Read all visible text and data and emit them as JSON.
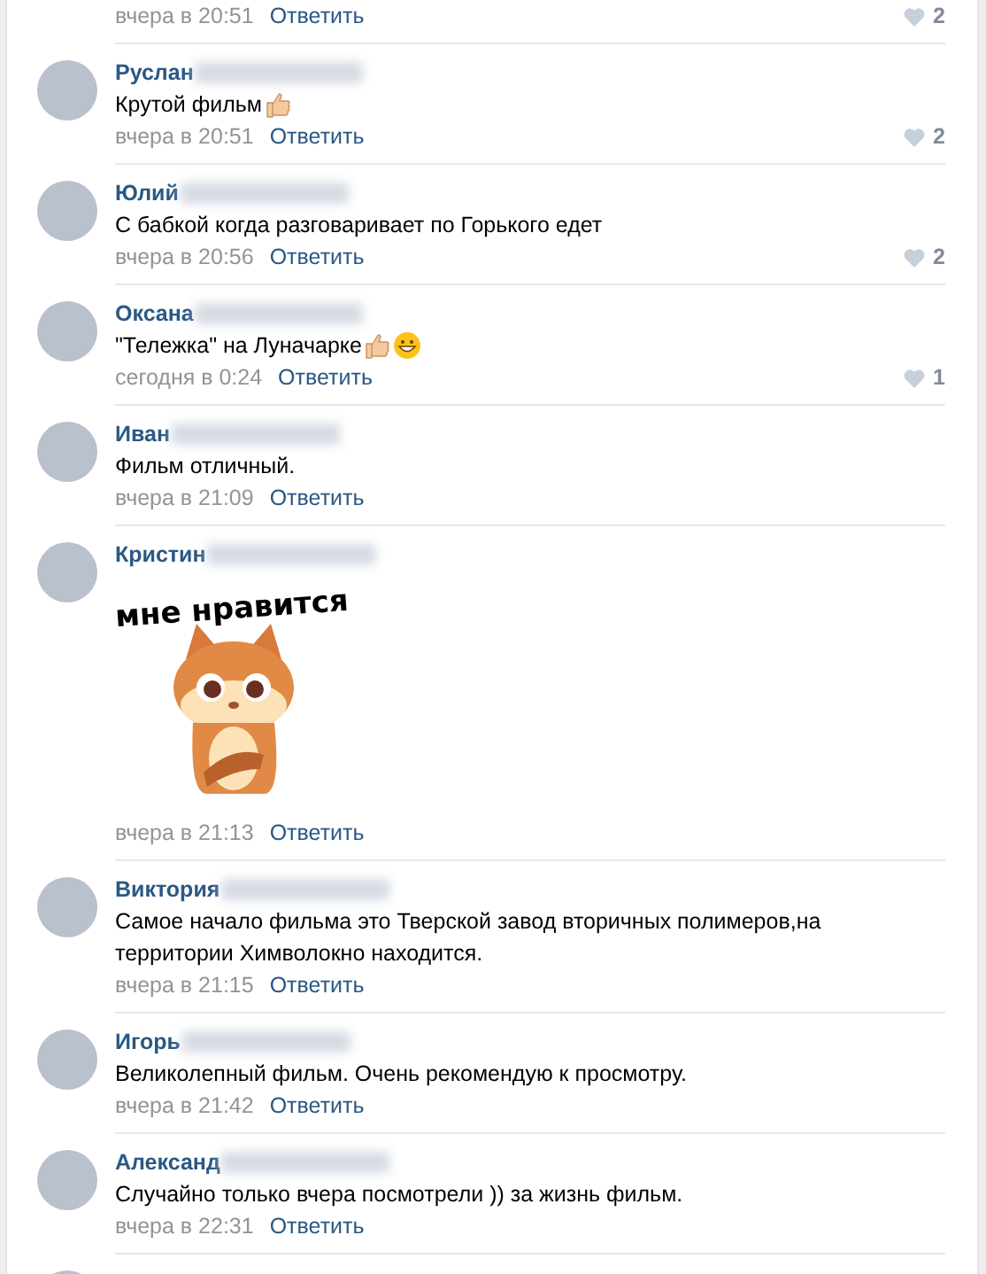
{
  "comments": [
    {
      "time": "вчера в 20:51",
      "reply": "Ответить",
      "likes": "2"
    },
    {
      "name": "Руслан",
      "text": "Крутой фильм",
      "emoji": [
        {
          "kind": "thumbs_up"
        }
      ],
      "time": "вчера в 20:51",
      "reply": "Ответить",
      "likes": "2"
    },
    {
      "name": "Юлий",
      "text": "С бабкой когда разговаривает по Горького едет",
      "time": "вчера в 20:56",
      "reply": "Ответить",
      "likes": "2"
    },
    {
      "name": "Оксана",
      "text": "\"Тележка\" на Луначарке",
      "emoji": [
        {
          "kind": "thumbs_up"
        },
        {
          "kind": "grin"
        }
      ],
      "time": "сегодня в 0:24",
      "reply": "Ответить",
      "likes": "1"
    },
    {
      "name": "Иван",
      "text": "Фильм отличный.",
      "time": "вчера в 21:09",
      "reply": "Ответить"
    },
    {
      "name": "Кристин",
      "sticker": {
        "caption": "мне нравится"
      },
      "time": "вчера в 21:13",
      "reply": "Ответить"
    },
    {
      "name": "Виктория",
      "text": "Самое начало фильма это Тверской завод вторичных полимеров,на территории Химволокно находится.",
      "time": "вчера в 21:15",
      "reply": "Ответить"
    },
    {
      "name": "Игорь",
      "text": "Великолепный фильм. Очень рекомендую к просмотру.",
      "time": "вчера в 21:42",
      "reply": "Ответить"
    },
    {
      "name": "Александ",
      "text": "Случайно только вчера посмотрели )) за жизнь фильм.",
      "time": "вчера в 22:31",
      "reply": "Ответить"
    }
  ]
}
